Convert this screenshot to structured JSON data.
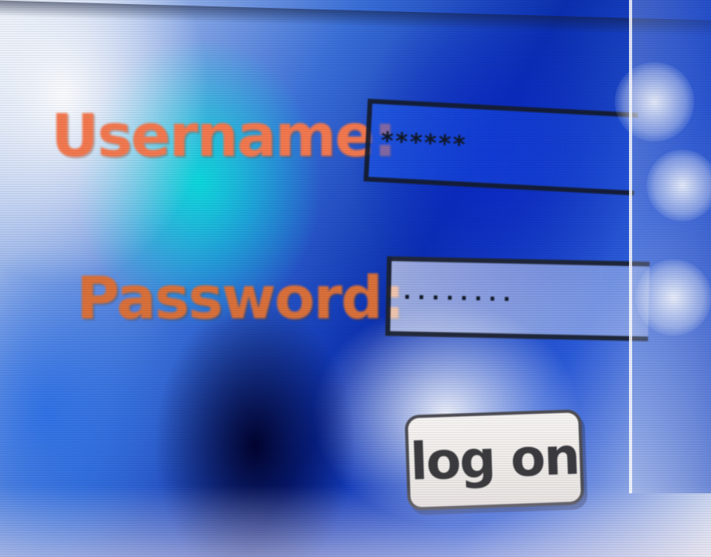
{
  "login_form": {
    "username_label": "Username:",
    "username_value": "******",
    "password_label": "Password:",
    "password_value": "········",
    "logon_button_label": "log on"
  }
}
